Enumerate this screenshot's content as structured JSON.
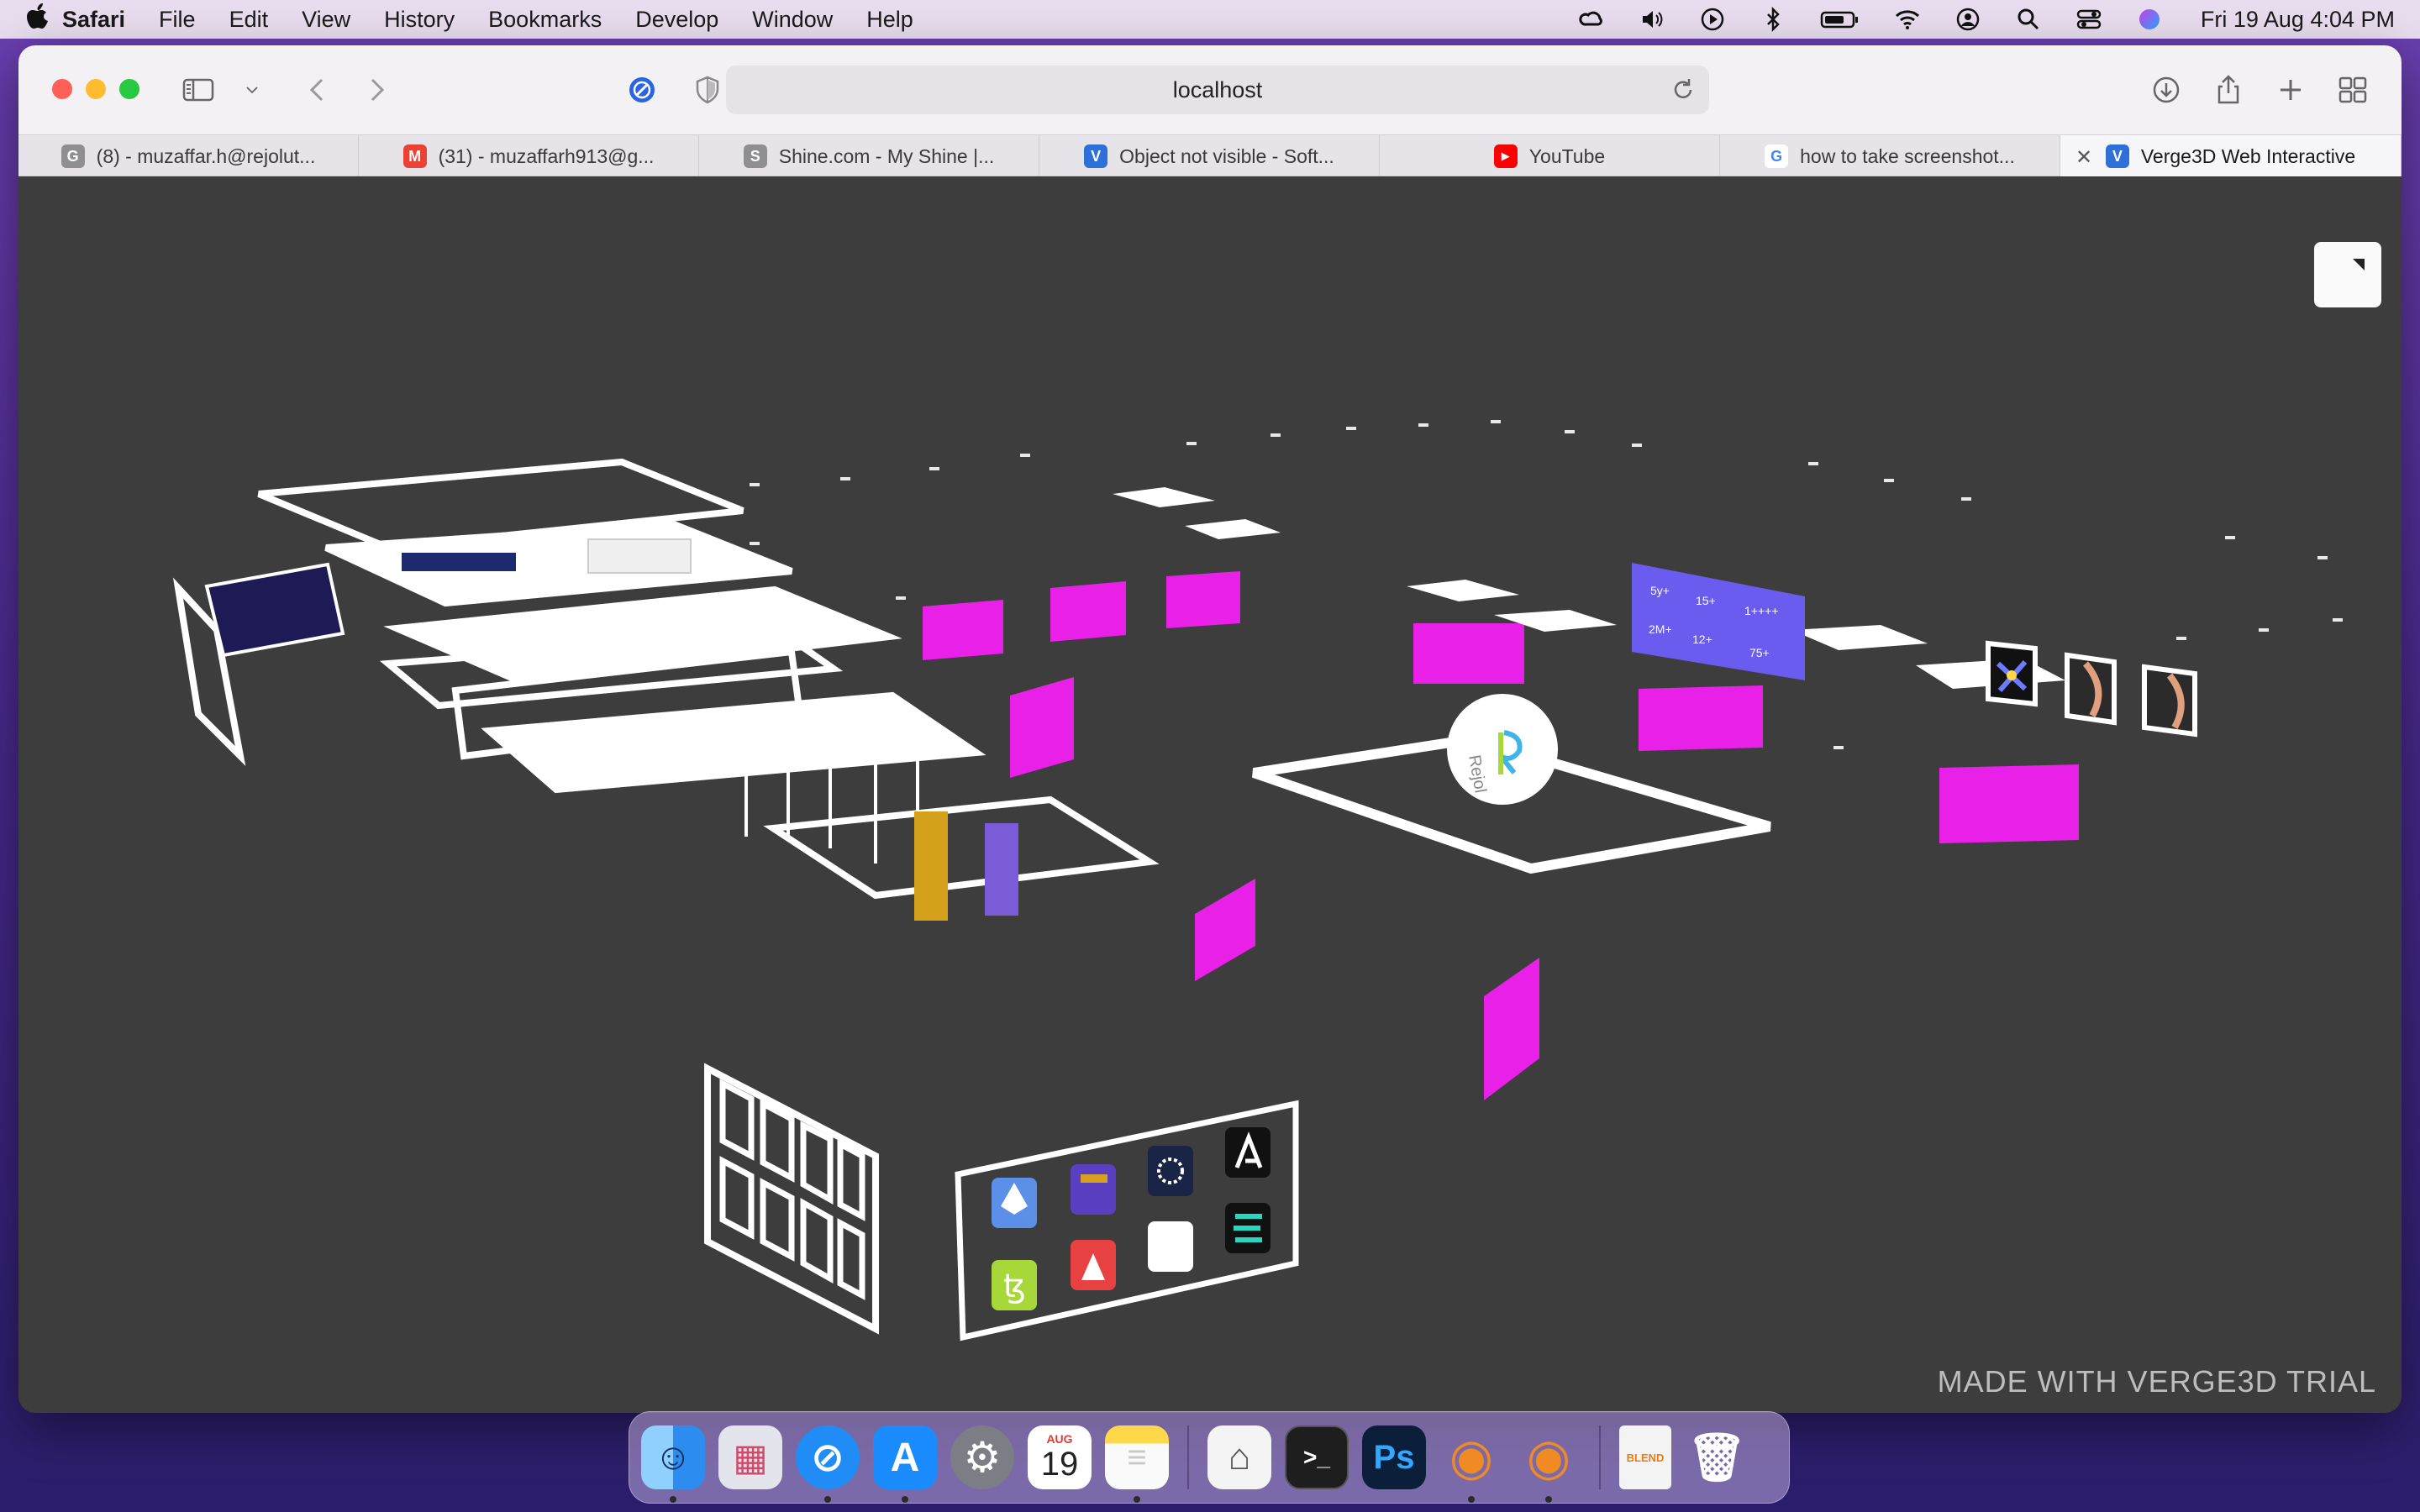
{
  "menubar": {
    "app_name": "Safari",
    "items": [
      "File",
      "Edit",
      "View",
      "History",
      "Bookmarks",
      "Develop",
      "Window",
      "Help"
    ],
    "clock": "Fri 19 Aug  4:04 PM",
    "status_icons": [
      "creative-cloud-icon",
      "volume-icon",
      "play-icon",
      "bluetooth-icon",
      "battery-icon",
      "wifi-icon",
      "user-icon",
      "search-icon",
      "control-center-icon",
      "siri-icon"
    ]
  },
  "toolbar": {
    "address": "localhost"
  },
  "tabs": [
    {
      "label": "(8) - muzaffar.h@rejolut...",
      "favicon": "G",
      "color": "#8e8e93"
    },
    {
      "label": "(31) - muzaffarh913@g...",
      "favicon": "M",
      "color": "#ea4335"
    },
    {
      "label": "Shine.com - My Shine |...",
      "favicon": "S",
      "color": "#8e8e93"
    },
    {
      "label": "Object not visible - Soft...",
      "favicon": "V",
      "color": "#2f6fd8"
    },
    {
      "label": "YouTube",
      "favicon": "▶",
      "color": "#ff0000"
    },
    {
      "label": "how to take screenshot...",
      "favicon": "G",
      "color": "#4285f4"
    },
    {
      "label": "Verge3D Web Interactive",
      "favicon": "V",
      "color": "#2f6fd8",
      "active": true
    }
  ],
  "scene": {
    "watermark": "MADE WITH VERGE3D TRIAL",
    "colors": {
      "background": "#3d3d3d",
      "magenta": "#e820e8",
      "wire": "#ffffff",
      "stats_panel": "#6b5cf0"
    },
    "stats_panel_labels": [
      "5y+",
      "15+",
      "1++++",
      "2M+",
      "12+",
      "75+"
    ],
    "logo_text": "Rejol"
  },
  "dock": {
    "apps": [
      {
        "name": "finder",
        "glyph": "☺",
        "color": "#2d8cf0",
        "running": true
      },
      {
        "name": "launchpad",
        "glyph": "▦",
        "color": "#d9d9e0",
        "running": false
      },
      {
        "name": "safari",
        "glyph": "⊘",
        "color": "#1f8df5",
        "running": true
      },
      {
        "name": "app-store",
        "glyph": "A",
        "color": "#1a8cff",
        "running": true
      },
      {
        "name": "system-preferences",
        "glyph": "⚙",
        "color": "#7d7d85",
        "running": false
      },
      {
        "name": "calendar",
        "glyph": "19",
        "color": "#ffffff",
        "running": false
      },
      {
        "name": "notes",
        "glyph": "≡",
        "color": "#ffd84a",
        "running": true
      },
      {
        "name": "separator"
      },
      {
        "name": "scanner",
        "glyph": "⌂",
        "color": "#f4f4f4",
        "running": false
      },
      {
        "name": "terminal",
        "glyph": ">_",
        "color": "#1e1e1e",
        "running": false
      },
      {
        "name": "photoshop",
        "glyph": "Ps",
        "color": "#0b1e3a",
        "running": false
      },
      {
        "name": "blender",
        "glyph": "◉",
        "color": "#f08a24",
        "running": true
      },
      {
        "name": "blender-2",
        "glyph": "◉",
        "color": "#f08a24",
        "running": true
      },
      {
        "name": "separator"
      },
      {
        "name": "blend-file",
        "glyph": "BLEND",
        "color": "#f3f3f3",
        "running": false
      },
      {
        "name": "trash",
        "glyph": "🗑",
        "color": "#d8d8de",
        "running": false
      }
    ],
    "calendar_month": "AUG"
  }
}
